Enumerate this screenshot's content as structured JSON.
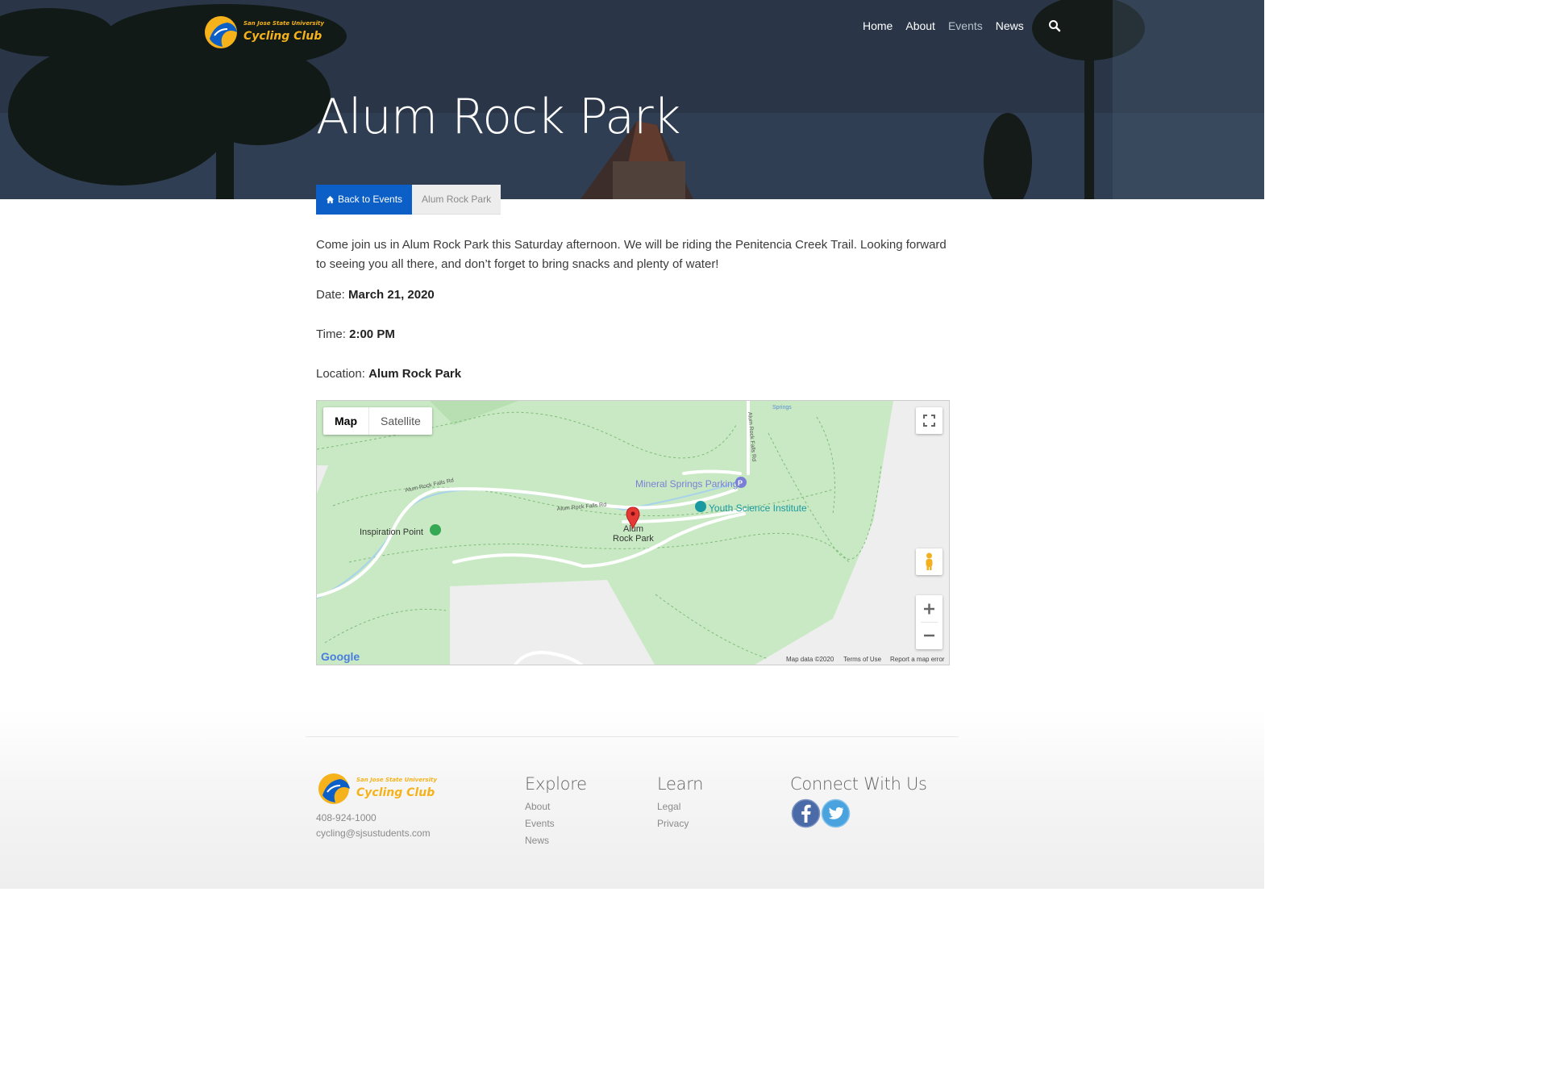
{
  "header": {
    "logo_text_small": "San Jose State University",
    "logo_text_main": "Cycling Club",
    "nav": [
      "Home",
      "About",
      "Events",
      "News"
    ],
    "active_nav": "Events",
    "search_icon": "search-icon"
  },
  "page": {
    "title": "Alum Rock Park",
    "breadcrumb": {
      "back_label": "Back to Events",
      "current": "Alum Rock Park"
    }
  },
  "event": {
    "description": "Come join us in Alum Rock Park this Saturday afternoon. We will be riding the Penitencia Creek Trail. Looking forward to seeing you all there, and don’t forget to bring snacks and plenty of water!",
    "date_label": "Date:",
    "date_value": "March 21, 2020",
    "time_label": "Time:",
    "time_value": "2:00 PM",
    "location_label": "Location:",
    "location_value": "Alum Rock Park"
  },
  "map": {
    "type_map": "Map",
    "type_satellite": "Satellite",
    "labels": {
      "mineral_springs_parking": "Mineral Springs Parking",
      "youth_science": "Youth Science Institute",
      "inspiration_point": "Inspiration Point",
      "alum_rock_park_line1": "Alum",
      "alum_rock_park_line2": "Rock Park",
      "road1": "Alum Rock Falls Rd",
      "road2": "Alum Rock Falls Rd",
      "road3": "Alum Rock Falls Rd",
      "springs": "Springs"
    },
    "attribution": {
      "data": "Map data ©2020",
      "terms": "Terms of Use",
      "report": "Report a map error"
    },
    "google": "Google"
  },
  "footer": {
    "phone": "408-924-1000",
    "email": "cycling@sjsustudents.com",
    "explore": {
      "title": "Explore",
      "links": [
        "About",
        "Events",
        "News"
      ]
    },
    "learn": {
      "title": "Learn",
      "links": [
        "Legal",
        "Privacy"
      ]
    },
    "connect": {
      "title": "Connect With Us"
    }
  },
  "colors": {
    "primary_blue": "#0b5fc6",
    "logo_gold": "#f5b21a",
    "map_green": "#c8e9c3",
    "pin_red": "#e53935"
  }
}
